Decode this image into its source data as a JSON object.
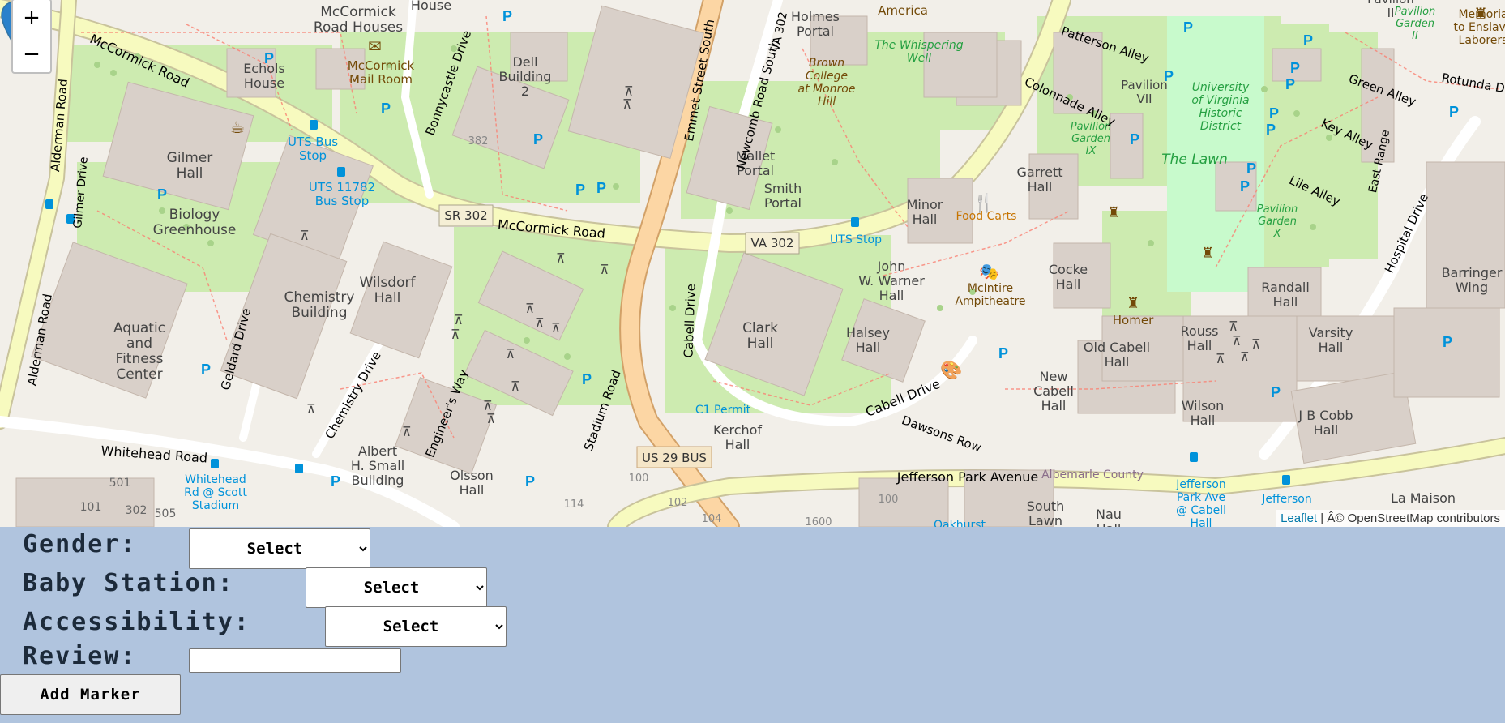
{
  "map": {
    "zoom_in": "+",
    "zoom_out": "−",
    "attribution_link": "Leaflet",
    "attribution_text": " | Â© OpenStreetMap contributors",
    "labels": {
      "mccormick_houses": "McCormick\nRoad Houses",
      "mccormick_mail": "McCormick\nMail Room",
      "echols": "Echols\nHouse",
      "dell2": "Dell\nBuilding\n2",
      "holmes": "Holmes\nPortal",
      "america": "America",
      "whispering": "The Whispering\nWell",
      "brown": "Brown\nCollege\nat Monroe\nHill",
      "gilmer": "Gilmer\nHall",
      "uts_bus_stop": "UTS Bus\nStop",
      "uts11782": "UTS 11782\nBus Stop",
      "sr302": "SR 302",
      "mccormick_road": "McCormick Road",
      "va302_shield": "VA 302",
      "uts_stop": "UTS Stop",
      "biology": "Biology\nGreenhouse",
      "mallet": "Mallet\nPortal",
      "smith": "Smith\nPortal",
      "minor": "Minor\nHall",
      "garrett": "Garrett\nHall",
      "food_carts": "Food Carts",
      "chem_bldg": "Chemistry\nBuilding",
      "wilsdorf": "Wilsdorf\nHall",
      "john_warner": "John\nW. Warner\nHall",
      "mcintire": "McIntire\nAmpitheatre",
      "cocke": "Cocke\nHall",
      "aquatic": "Aquatic\nand\nFitness\nCenter",
      "clark": "Clark\nHall",
      "halsey": "Halsey\nHall",
      "homer": "Homer",
      "rouss": "Rouss\nHall",
      "old_cabell": "Old Cabell\nHall",
      "randall": "Randall\nHall",
      "varsity": "Varsity\nHall",
      "new_cabell": "New\nCabell\nHall",
      "wilson": "Wilson\nHall",
      "jb_cobb": "J B Cobb\nHall",
      "c1_permit": "C1 Permit",
      "kerchof": "Kerchof\nHall",
      "us29": "US 29 BUS",
      "whitehead_road": "Whitehead Road",
      "whitehead_stop": "Whitehead\nRd @ Scott\nStadium",
      "albert_small": "Albert\nH. Small\nBuilding",
      "olsson": "Olsson\nHall",
      "jefferson_park": "Jefferson Park Avenue",
      "albemarle": "Albemarle County",
      "south_lawn": "South\nLawn",
      "nau": "Nau\nHall",
      "oakhurst": "Oakhurst",
      "jpa_cabell": "Jefferson\nPark Ave\n@ Cabell\nHall",
      "jefferson_stop": "Jefferson",
      "la_maison": "La Maison",
      "barringer": "Barringer\nWing",
      "hospital_drive": "Hospital Drive",
      "pavilion_vii": "Pavilion\nVII",
      "pavilion_ix": "Pavilion\nGarden\nIX",
      "pavilion_x": "Pavilion\nGarden\nX",
      "pavilion_ii": "Pavilion\nGarden\nII",
      "pav_ii_top": "Pavilion\nII",
      "uva_district": "University\nof Virginia\nHistoric\nDistrict",
      "the_lawn": "The Lawn",
      "memorial": "Memoria\nto Enslave\nLaborers",
      "alderman_road": "Alderman Road",
      "gilmer_drive": "Gilmer Drive",
      "geldard_drive": "Geldard Drive",
      "chemistry_drive": "Chemistry Drive",
      "engineers_way": "Engineer's Way",
      "stadium_road": "Stadium Road",
      "bonnycastle": "Bonnycastle Drive",
      "emmet": "Emmet Street South",
      "newcomb": "Newcomb Road South",
      "cabell_drive_v": "Cabell Drive",
      "cabell_drive": "Cabell Drive",
      "dawsons_row": "Dawsons Row",
      "patterson": "Patterson Alley",
      "colonnade": "Colonnade Alley",
      "green_alley": "Green Alley",
      "key_alley": "Key Alley",
      "lile_alley": "Lile Alley",
      "rotunda": "Rotunda Dr",
      "east_range": "East Range",
      "va302_vert": "VA 302",
      "hall_partial": "House",
      "num_382": "382",
      "num_501": "501",
      "num_101": "101",
      "num_302": "302",
      "num_505": "505",
      "num_100a": "100",
      "num_102": "102",
      "num_104": "104",
      "num_114": "114",
      "num_100b": "100",
      "num_1600": "1600"
    }
  },
  "form": {
    "gender_label": "Gender:",
    "gender_value": "Select",
    "baby_label": "Baby Station:",
    "baby_value": "Select",
    "access_label": "Accessibility:",
    "access_value": "Select",
    "review_label": "Review:",
    "review_value": "",
    "add_button": "Add Marker"
  },
  "colors": {
    "panel_bg": "#b0c4de",
    "map_bg": "#f2efe9",
    "building": "#d9d0c9",
    "grass": "#cdebb0",
    "road_yellow": "#f7fabf",
    "road_orange": "#fcd6a4",
    "marker": "#2a81cb"
  }
}
